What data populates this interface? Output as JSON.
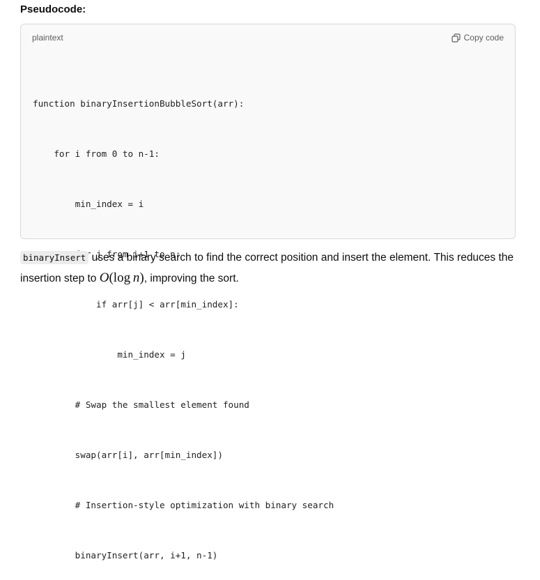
{
  "heading": "Pseudocode:",
  "code_block": {
    "language": "plaintext",
    "copy_label": "Copy code",
    "copy_icon": "copy-icon",
    "lines": [
      "function binaryInsertionBubbleSort(arr):",
      "    for i from 0 to n-1:",
      "        min_index = i",
      "        for j from i+1 to n:",
      "            if arr[j] < arr[min_index]:",
      "                min_index = j",
      "        # Swap the smallest element found",
      "        swap(arr[i], arr[min_index])",
      "        # Insertion-style optimization with binary search",
      "        binaryInsert(arr, i+1, n-1)"
    ]
  },
  "paragraph": {
    "inline_code": "binaryInsert",
    "text_before_math": " uses a binary search to find the correct position and insert the element. This reduces the insertion step to ",
    "math_O": "O",
    "math_open": "(",
    "math_log": "log",
    "math_n": "n",
    "math_close": ")",
    "text_after_math": ", improving the sort."
  }
}
